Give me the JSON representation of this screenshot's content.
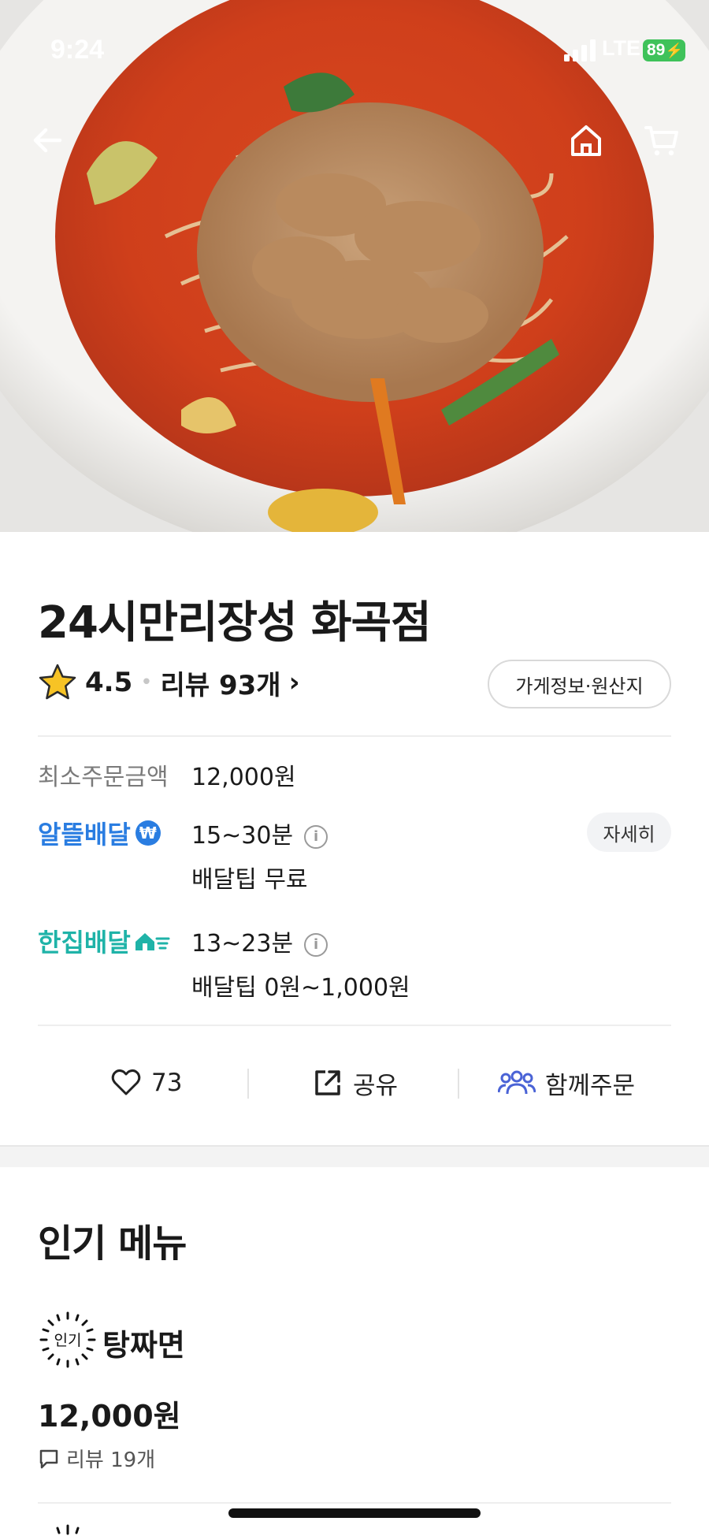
{
  "status_bar": {
    "time": "9:24",
    "network": "LTE",
    "battery": "89"
  },
  "nav": {
    "back_icon": "arrow-left-icon",
    "home_icon": "home-icon",
    "cart_icon": "cart-icon"
  },
  "store": {
    "name": "24시만리장성 화곡점",
    "rating": "4.5",
    "reviews_label": "리뷰 93개",
    "info_button": "가게정보·원산지"
  },
  "order_info": {
    "min_order_label": "최소주문금액",
    "min_order_value": "12,000원",
    "delivery_options": [
      {
        "brand": "알뜰배달",
        "time": "15~30분",
        "tip": "배달팁 무료",
        "detail_button": "자세히"
      },
      {
        "brand": "한집배달",
        "time": "13~23분",
        "tip": "배달팁 0원~1,000원"
      }
    ]
  },
  "actions": {
    "likes": "73",
    "share": "공유",
    "group_order": "함께주문"
  },
  "popular_menu": {
    "title": "인기 메뉴",
    "badge": "인기",
    "items": [
      {
        "name": "탕짜면",
        "price": "12,000원",
        "reviews": "리뷰 19개"
      }
    ]
  },
  "colors": {
    "blue_brand": "#2a7de1",
    "teal_brand": "#1fb3a8",
    "group_order_icon": "#4a63d6"
  }
}
